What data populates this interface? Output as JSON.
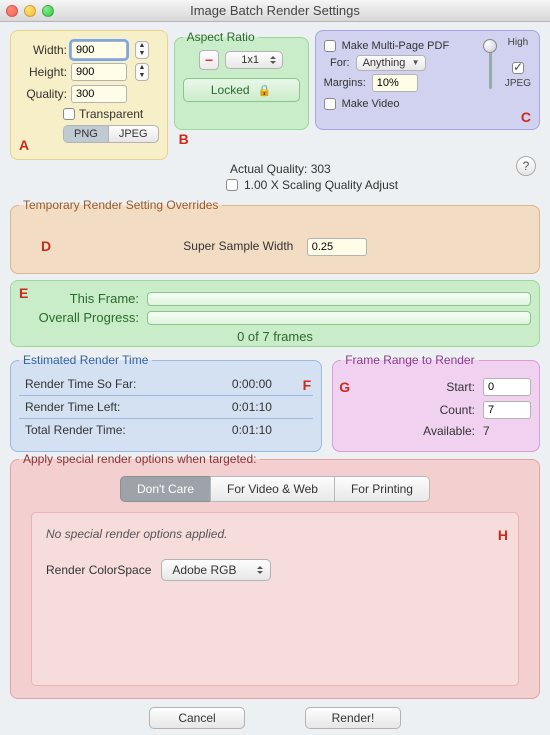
{
  "window": {
    "title": "Image Batch Render Settings"
  },
  "size": {
    "width_label": "Width:",
    "width_value": "900",
    "height_label": "Height:",
    "height_value": "900",
    "quality_label": "Quality:",
    "quality_value": "300",
    "transparent_label": "Transparent",
    "transparent_checked": false,
    "fmt_png": "PNG",
    "fmt_jpeg": "JPEG",
    "fmt_active": "PNG"
  },
  "aspect": {
    "legend": "Aspect Ratio",
    "ratio_value": "1x1",
    "locked_label": "Locked",
    "link_icon": "minus-icon",
    "lock_icon": "lock-icon"
  },
  "pdf": {
    "make_multipage_label": "Make Multi-Page PDF",
    "make_multipage_checked": false,
    "for_label": "For:",
    "for_value": "Anything",
    "margins_label": "Margins:",
    "margins_value": "10%",
    "make_video_label": "Make Video",
    "make_video_checked": false,
    "slider_top_label": "High",
    "right_toggle_checked": true,
    "right_toggle_caption": "JPEG"
  },
  "quality_info": {
    "actual_quality_label": "Actual Quality: 303",
    "scaling_label": "1.00 X Scaling Quality Adjust",
    "scaling_checked": false
  },
  "overrides": {
    "legend": "Temporary Render  Setting Overrides",
    "ssw_label": "Super Sample Width",
    "ssw_value": "0.25"
  },
  "progress": {
    "this_frame_label": "This Frame:",
    "overall_label": "Overall Progress:",
    "frames_text": "0 of 7 frames"
  },
  "rendertime": {
    "legend": "Estimated Render Time",
    "sofar_label": "Render Time So Far:",
    "sofar_value": "0:00:00",
    "left_label": "Render Time Left:",
    "left_value": "0:01:10",
    "total_label": "Total Render Time:",
    "total_value": "0:01:10"
  },
  "framerange": {
    "legend": "Frame Range to Render",
    "start_label": "Start:",
    "start_value": "0",
    "count_label": "Count:",
    "count_value": "7",
    "available_label": "Available:",
    "available_value": "7"
  },
  "special": {
    "legend": "Apply special render options when targeted:",
    "tab1": "Don't Care",
    "tab2": "For Video & Web",
    "tab3": "For Printing",
    "active_tab": "Don't Care",
    "note": "No special render options applied.",
    "colorspace_label": "Render ColorSpace",
    "colorspace_value": "Adobe RGB"
  },
  "footer": {
    "cancel": "Cancel",
    "render": "Render!"
  },
  "markers": {
    "A": "A",
    "B": "B",
    "C": "C",
    "D": "D",
    "E": "E",
    "F": "F",
    "G": "G",
    "H": "H"
  }
}
